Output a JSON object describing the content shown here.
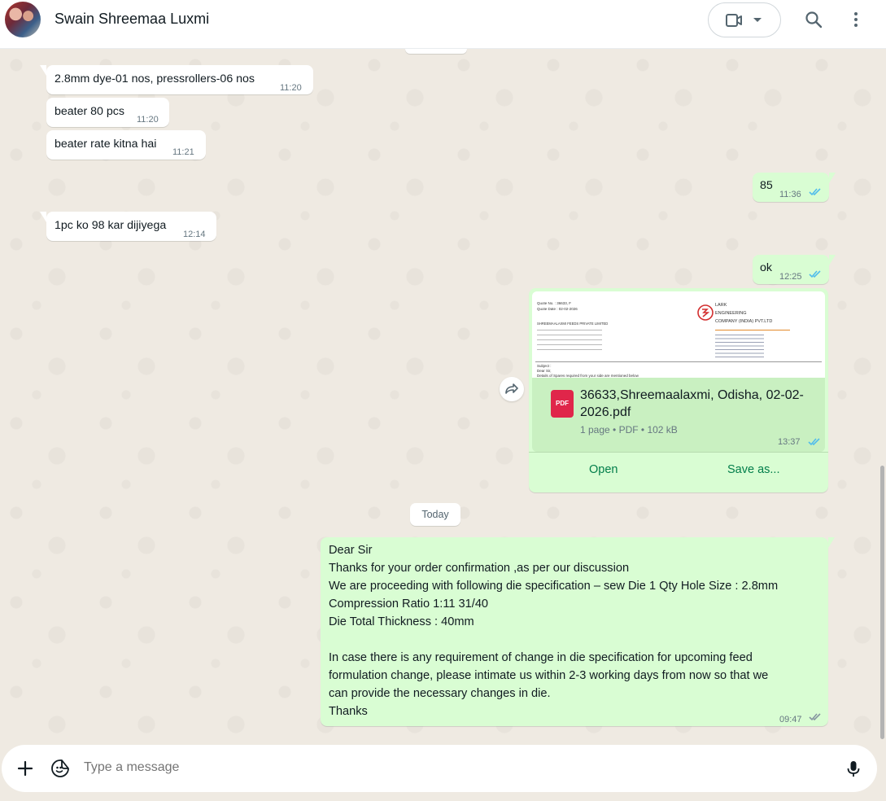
{
  "header": {
    "contact_name": "Swain Shreemaa Luxmi"
  },
  "messages": [
    {
      "dir": "in",
      "text": "2.8mm dye-01 nos, pressrollers-06 nos",
      "time": "11:20"
    },
    {
      "dir": "in",
      "text": "beater 80 pcs",
      "time": "11:20"
    },
    {
      "dir": "in",
      "text": "beater rate kitna hai",
      "time": "11:21"
    },
    {
      "dir": "out",
      "text": "85",
      "time": "11:36"
    },
    {
      "dir": "in",
      "text": "1pc ko 98 kar dijiyega",
      "time": "12:14"
    },
    {
      "dir": "out",
      "text": "ok",
      "time": "12:25"
    }
  ],
  "document": {
    "file_name": "36633,Shreemaalaxmi, Odisha, 02-02-2026.pdf",
    "file_type_badge": "PDF",
    "meta": "1 page • PDF • 102 kB",
    "time": "13:37",
    "open_label": "Open",
    "save_label": "Save as...",
    "preview": {
      "quote_no": "Quote No. : 36633, F",
      "quote_date": "Quote Date : 02-02-2026",
      "company_lines": [
        "LARK",
        "ENGINEERING",
        "COMPANY (INDIA) PVT.LTD"
      ],
      "customer": "SHREEMAALAXMI FEEDS PRIVATE LIMITED",
      "subject": "Subject :",
      "salutation": "Dear Sir,",
      "body": "Details of Spares required from your side are mentioned below"
    }
  },
  "day_separator": "Today",
  "long_message": {
    "lines": [
      "Dear Sir",
      "Thanks for your order confirmation ,as per our discussion",
      "We are proceeding with following die specification –  sew Die 1 Qty Hole Size :  2.8mm",
      "Compression Ratio 1:11 31/40",
      "Die Total Thickness : 40mm",
      "",
      "In case there is any requirement of change in die specification for upcoming feed",
      "formulation change, please intimate us within 2-3 working days from now so that we",
      "can provide the necessary changes in die.",
      "Thanks"
    ],
    "time": "09:47"
  },
  "composer": {
    "placeholder": "Type a message"
  },
  "colors": {
    "read_ticks": "#53bdeb",
    "delivered_ticks": "#8696a0",
    "accent_green": "#027e4a"
  },
  "icons": [
    "avatar",
    "video-call-icon",
    "chevron-down-icon",
    "search-icon",
    "more-vert-icon",
    "forward-icon",
    "pdf-icon",
    "plus-icon",
    "sticker-icon",
    "mic-icon",
    "double-tick-icon"
  ]
}
